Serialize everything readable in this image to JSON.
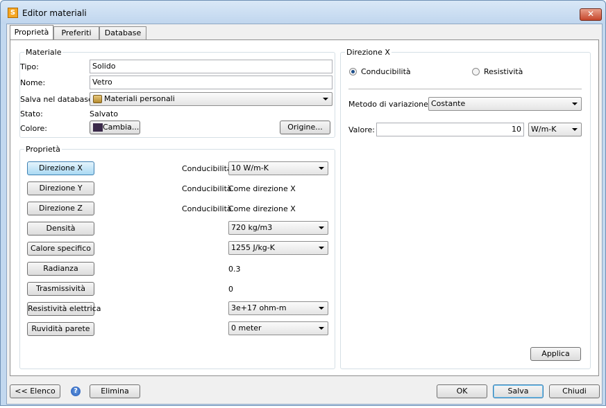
{
  "window": {
    "title": "Editor materiali"
  },
  "tabs": [
    "Proprietà",
    "Preferiti",
    "Database"
  ],
  "material": {
    "group_title": "Materiale",
    "tipo_label": "Tipo:",
    "tipo_value": "Solido",
    "nome_label": "Nome:",
    "nome_value": "Vetro",
    "salva_label": "Salva nel database:",
    "salva_value": "Materiali personali",
    "stato_label": "Stato:",
    "stato_value": "Salvato",
    "colore_label": "Colore:",
    "cambia_label": "Cambia...",
    "origine_label": "Origine...",
    "color": "#3b2a4a"
  },
  "properties": {
    "group_title": "Proprietà",
    "rows": [
      {
        "button": "Direzione X",
        "label": "Conducibilità",
        "value": "10 W/m-K",
        "kind": "combo"
      },
      {
        "button": "Direzione Y",
        "label": "Conducibilità",
        "value": "Come direzione X",
        "kind": "text"
      },
      {
        "button": "Direzione Z",
        "label": "Conducibilità",
        "value": "Come direzione X",
        "kind": "text"
      },
      {
        "button": "Densità",
        "label": "",
        "value": "720 kg/m3",
        "kind": "combo"
      },
      {
        "button": "Calore specifico",
        "label": "",
        "value": "1255 J/kg-K",
        "kind": "combo"
      },
      {
        "button": "Radianza",
        "label": "",
        "value": "0.3",
        "kind": "text"
      },
      {
        "button": "Trasmissività",
        "label": "",
        "value": "0",
        "kind": "text"
      },
      {
        "button": "Resistività elettrica",
        "label": "",
        "value": "3e+17 ohm-m",
        "kind": "combo"
      },
      {
        "button": "Ruvidità parete",
        "label": "",
        "value": "0 meter",
        "kind": "combo"
      }
    ]
  },
  "direction": {
    "group_title": "Direzione X",
    "radio_conducibilita": "Conducibilità",
    "radio_resistivita": "Resistività",
    "metodo_label": "Metodo di variazione:",
    "metodo_value": "Costante",
    "valore_label": "Valore:",
    "valore_value": "10",
    "unit_value": "W/m-K",
    "applica_label": "Applica"
  },
  "footer": {
    "elenco_label": "<< Elenco",
    "help_symbol": "?",
    "elimina_label": "Elimina",
    "ok_label": "OK",
    "salva_label": "Salva",
    "chiudi_label": "Chiudi"
  }
}
